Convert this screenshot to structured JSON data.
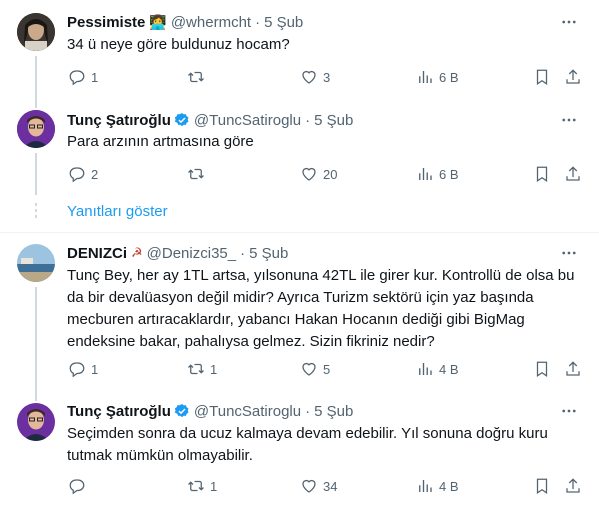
{
  "tweets": [
    {
      "name": "Pessimiste",
      "badge_emoji": "👩‍💻",
      "handle": "@whermcht",
      "sep": "·",
      "date": "5 Şub",
      "text": "34 ü neye göre buldunuz hocam?",
      "replies": "1",
      "retweets": "",
      "likes": "3",
      "views": "6 B"
    },
    {
      "name": "Tunç Şatıroğlu",
      "handle": "@TuncSatiroglu",
      "sep": "·",
      "date": "5 Şub",
      "text": "Para arzının artmasına göre",
      "replies": "2",
      "retweets": "",
      "likes": "20",
      "views": "6 B"
    },
    {
      "name": "DENIZCi",
      "badge_emoji": "☭",
      "handle": "@Denizci35_",
      "sep": "·",
      "date": "5 Şub",
      "text_lines": [
        "Tunç Bey, her ay 1TL artsa, yılsonuna 42TL ile girer kur. Kontrollü de olsa bu",
        "da bir devalüasyon değil midir? Ayrıca Turizm sektörü için yaz başında",
        "mecburen artıracaklardır, yabancı Hakan Hocanın dediği gibi BigMag",
        "endeksine bakar, pahalıysa gelmez. Sizin fikriniz nedir?"
      ],
      "replies": "1",
      "retweets": "1",
      "likes": "5",
      "views": "4 B"
    },
    {
      "name": "Tunç Şatıroğlu",
      "handle": "@TuncSatiroglu",
      "sep": "·",
      "date": "5 Şub",
      "text_lines": [
        "Seçimden sonra da ucuz kalmaya devam edebilir. Yıl sonuna doğru kuru",
        "tutmak mümkün olmayabilir."
      ],
      "replies": "",
      "retweets": "1",
      "likes": "34",
      "views": "4 B"
    }
  ],
  "show_replies_label": "Yanıtları göster",
  "colors": {
    "accent": "#1d9bf0",
    "muted": "#536471",
    "text": "#0f1419",
    "line": "#cfd9de"
  }
}
